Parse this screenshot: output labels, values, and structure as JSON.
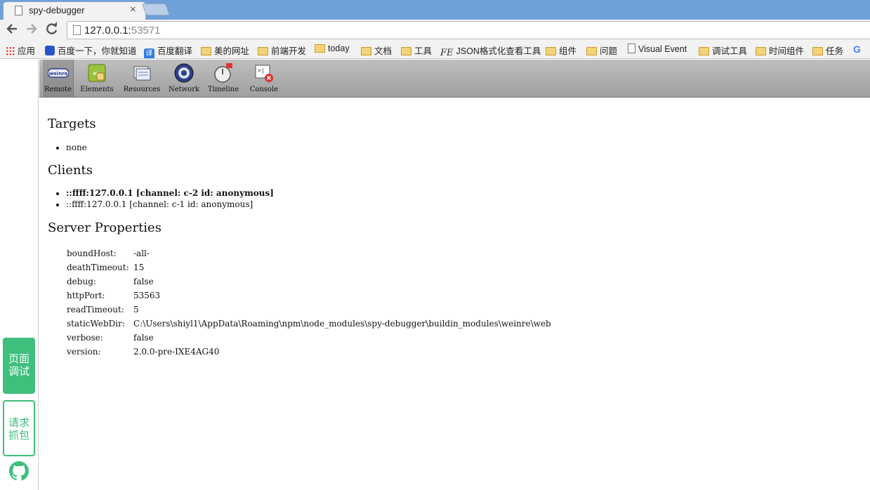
{
  "browser": {
    "tab_title": "spy-debugger",
    "tab_close": "×",
    "url_host": "127.0.0.1:",
    "url_port": "53571"
  },
  "bookmarks": [
    {
      "label": "应用",
      "icon": "apps-icon"
    },
    {
      "label": "百度一下，你就知道",
      "icon": "paw-icon"
    },
    {
      "label": "百度翻译",
      "icon": "translate-icon"
    },
    {
      "label": "美的网址",
      "icon": "folder-icon"
    },
    {
      "label": "前端开发",
      "icon": "folder-icon"
    },
    {
      "label": "today",
      "icon": "folder-icon"
    },
    {
      "label": "文档",
      "icon": "folder-icon"
    },
    {
      "label": "工具",
      "icon": "folder-icon"
    },
    {
      "label": "JSON格式化查看工具",
      "icon": "fe-icon"
    },
    {
      "label": "组件",
      "icon": "folder-icon"
    },
    {
      "label": "问题",
      "icon": "folder-icon"
    },
    {
      "label": "Visual Event",
      "icon": "page-icon"
    },
    {
      "label": "调试工具",
      "icon": "folder-icon"
    },
    {
      "label": "时间组件",
      "icon": "folder-icon"
    },
    {
      "label": "任务",
      "icon": "folder-icon"
    }
  ],
  "dock": {
    "page_debug_line1": "页面",
    "page_debug_line2": "调试",
    "capture_line1": "请求",
    "capture_line2": "抓包"
  },
  "weinre_toolbar": {
    "remote": "Remote",
    "remote_badge": "weinre",
    "elements": "Elements",
    "resources": "Resources",
    "network": "Network",
    "timeline": "Timeline",
    "console": "Console"
  },
  "targets": {
    "title": "Targets",
    "items": [
      "none"
    ]
  },
  "clients": {
    "title": "Clients",
    "items": [
      "::ffff:127.0.0.1 [channel: c-2 id: anonymous]",
      "::ffff:127.0.0.1 [channel: c-1 id: anonymous]"
    ]
  },
  "server": {
    "title": "Server Properties",
    "props": [
      {
        "key": "boundHost:",
        "value": "-all-"
      },
      {
        "key": "deathTimeout:",
        "value": "15"
      },
      {
        "key": "debug:",
        "value": "false"
      },
      {
        "key": "httpPort:",
        "value": "53563"
      },
      {
        "key": "readTimeout:",
        "value": "5"
      },
      {
        "key": "staticWebDir:",
        "value": "C:\\Users\\shiyl1\\AppData\\Roaming\\npm\\node_modules\\spy-debugger\\buildin_modules\\weinre\\web"
      },
      {
        "key": "verbose:",
        "value": "false"
      },
      {
        "key": "version:",
        "value": "2.0.0-pre-IXE4AG40"
      }
    ]
  },
  "colors": {
    "accent_green": "#3ebf7c",
    "tabstrip": "#6fa0d8"
  }
}
